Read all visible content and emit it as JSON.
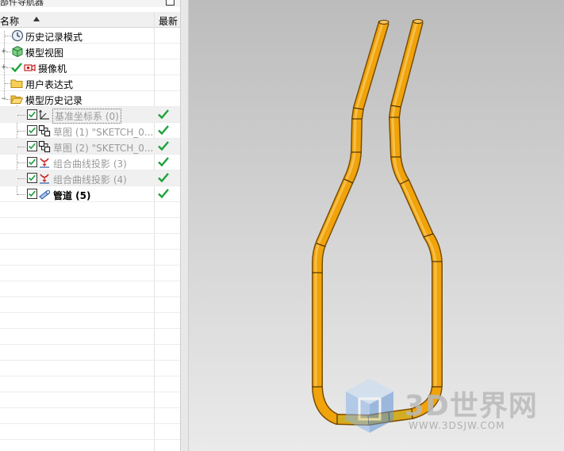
{
  "navigator": {
    "title": "部件导航器",
    "columns": {
      "name": "名称",
      "latest": "最新"
    },
    "rows": [
      {
        "label": "历史记录模式",
        "icon": "clock-icon"
      },
      {
        "label": "模型视图",
        "icon": "model-views-icon"
      },
      {
        "label": "摄像机",
        "icon": "camera-icon"
      },
      {
        "label": "用户表达式",
        "icon": "folder-icon"
      },
      {
        "label": "模型历史记录",
        "icon": "folder-open-icon"
      },
      {
        "label": "基准坐标系 (0)",
        "icon": "datum-csys-icon",
        "checked": true,
        "latest": true
      },
      {
        "label": "草图 (1) \"SKETCH_0...",
        "icon": "sketch-icon",
        "checked": true,
        "latest": true
      },
      {
        "label": "草图 (2) \"SKETCH_0...",
        "icon": "sketch-icon",
        "checked": true,
        "latest": true
      },
      {
        "label": "组合曲线投影 (3)",
        "icon": "combined-projection-icon",
        "checked": true,
        "latest": true
      },
      {
        "label": "组合曲线投影 (4)",
        "icon": "combined-projection-icon",
        "checked": true,
        "latest": true
      },
      {
        "label": "管道 (5)",
        "icon": "tube-icon",
        "checked": true,
        "latest": true
      }
    ]
  },
  "viewport": {
    "watermark": {
      "text": "3D世界网",
      "url": "WWW.3DSJW.COM"
    },
    "colors": {
      "tube": "#f0a30a",
      "tube_dark": "#c77800",
      "tube_highlight": "#f7c04a",
      "edge": "#3a2a00"
    }
  }
}
